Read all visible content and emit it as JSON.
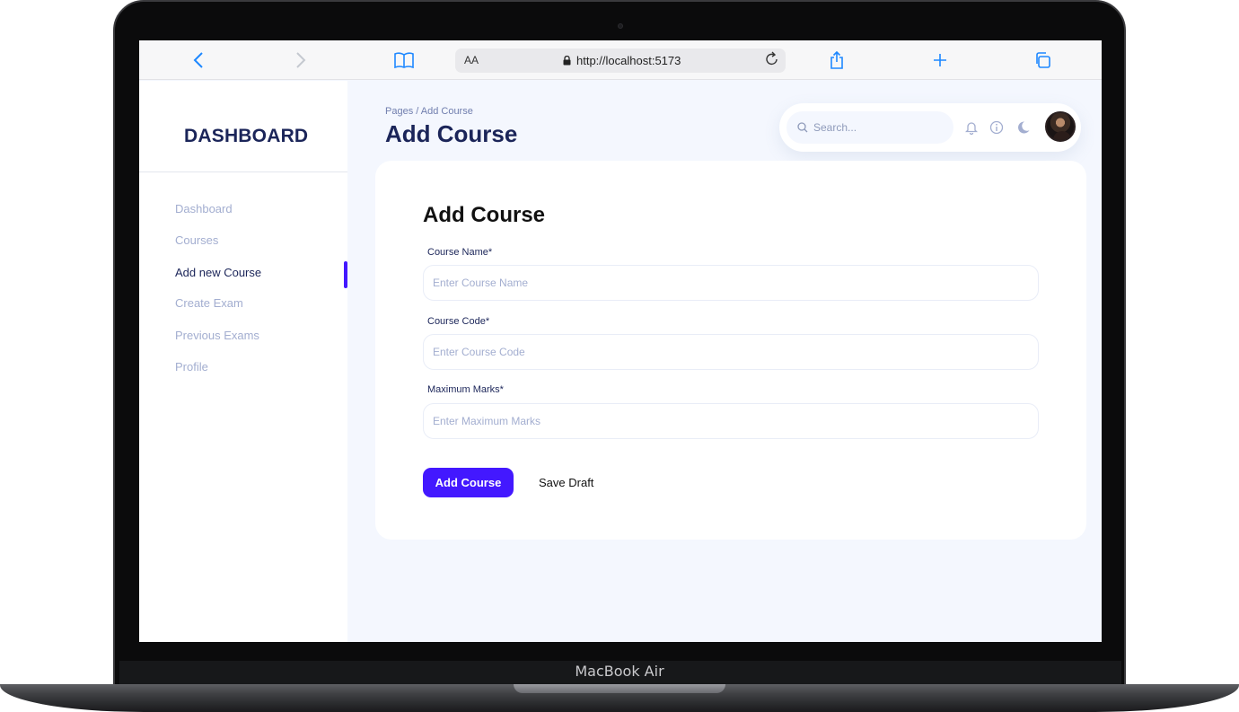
{
  "device": {
    "label": "MacBook Air"
  },
  "browser": {
    "url": "http://localhost:5173",
    "text_size_label": "AA",
    "icons": [
      "back-icon",
      "forward-icon",
      "bookmarks-icon",
      "lock-icon",
      "reload-icon",
      "share-icon",
      "new-tab-icon",
      "tabs-icon"
    ]
  },
  "sidebar": {
    "title": "DASHBOARD",
    "items": [
      {
        "label": "Dashboard",
        "active": false
      },
      {
        "label": "Courses",
        "active": false
      },
      {
        "label": "Add new Course",
        "active": true
      },
      {
        "label": "Create Exam",
        "active": false
      },
      {
        "label": "Previous Exams",
        "active": false
      },
      {
        "label": "Profile",
        "active": false
      }
    ]
  },
  "header": {
    "breadcrumb": "Pages / Add Course",
    "title": "Add Course",
    "search_placeholder": "Search...",
    "icons": [
      "bell-icon",
      "info-icon",
      "moon-icon"
    ]
  },
  "form": {
    "title": "Add Course",
    "fields": [
      {
        "label": "Course Name*",
        "placeholder": "Enter Course Name",
        "value": ""
      },
      {
        "label": "Course Code*",
        "placeholder": "Enter Course Code",
        "value": ""
      },
      {
        "label": "Maximum Marks*",
        "placeholder": "Enter Maximum Marks",
        "value": ""
      }
    ],
    "submit_label": "Add Course",
    "draft_label": "Save Draft"
  },
  "colors": {
    "accent": "#4318ff",
    "navy": "#1b2559",
    "muted": "#a3aed0",
    "page_bg": "#f4f7fe",
    "link_blue": "#1e88ff"
  }
}
